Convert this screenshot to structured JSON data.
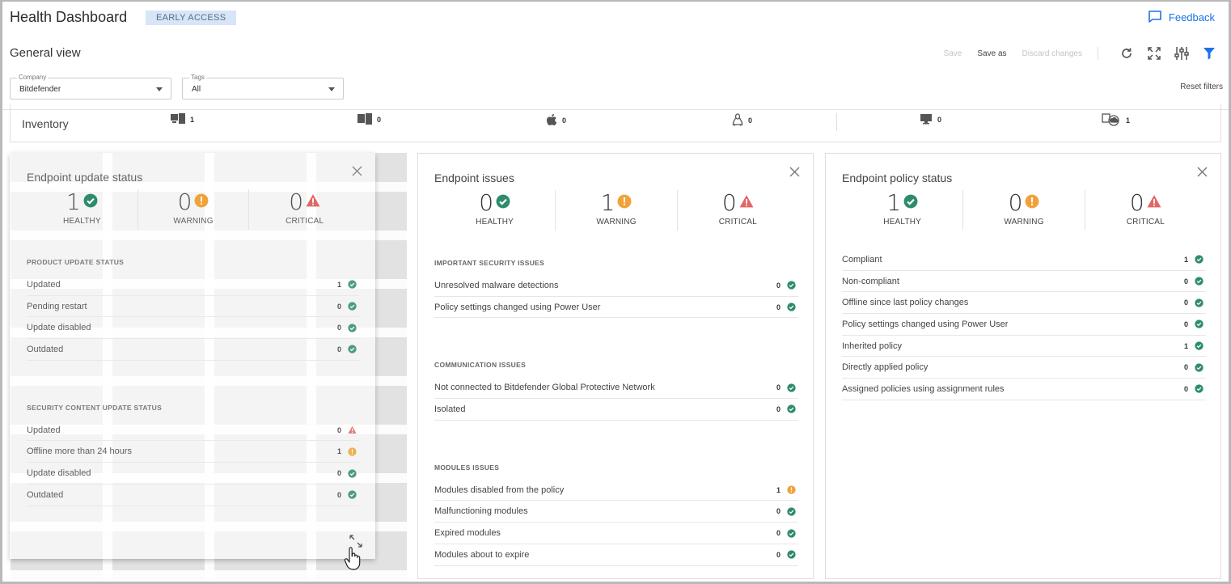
{
  "header": {
    "title": "Health Dashboard",
    "badge": "EARLY ACCESS",
    "feedback": "Feedback"
  },
  "view": {
    "name": "General view",
    "save": "Save",
    "save_as": "Save as",
    "discard": "Discard changes",
    "reset_filters": "Reset filters"
  },
  "filters": {
    "company": {
      "label": "Company",
      "value": "Bitdefender"
    },
    "tags": {
      "label": "Tags",
      "value": "All"
    }
  },
  "inventory": {
    "label": "Inventory",
    "items": [
      {
        "icon": "windows-workstation-icon",
        "count": "1"
      },
      {
        "icon": "windows-server-icon",
        "count": "0"
      },
      {
        "icon": "apple-icon",
        "count": "0"
      },
      {
        "icon": "linux-icon",
        "count": "0"
      },
      {
        "icon": "desktop-icon",
        "count": "0"
      },
      {
        "icon": "cloud-workload-icon",
        "count": "1"
      }
    ]
  },
  "colors": {
    "healthy": "#2e8b6e",
    "warning": "#f0a23a",
    "critical": "#e26666",
    "accent": "#1a73e8"
  },
  "cards": {
    "update": {
      "title": "Endpoint update status",
      "stats": [
        {
          "value": "1",
          "label": "HEALTHY",
          "status": "healthy"
        },
        {
          "value": "0",
          "label": "WARNING",
          "status": "warning"
        },
        {
          "value": "0",
          "label": "CRITICAL",
          "status": "critical"
        }
      ],
      "sections": [
        {
          "title": "PRODUCT UPDATE STATUS",
          "items": [
            {
              "label": "Updated",
              "count": "1",
              "status": "healthy"
            },
            {
              "label": "Pending restart",
              "count": "0",
              "status": "healthy"
            },
            {
              "label": "Update disabled",
              "count": "0",
              "status": "healthy"
            },
            {
              "label": "Outdated",
              "count": "0",
              "status": "healthy"
            }
          ]
        },
        {
          "title": "SECURITY CONTENT UPDATE STATUS",
          "items": [
            {
              "label": "Updated",
              "count": "0",
              "status": "critical"
            },
            {
              "label": "Offline more than 24 hours",
              "count": "1",
              "status": "warning"
            },
            {
              "label": "Update disabled",
              "count": "0",
              "status": "healthy"
            },
            {
              "label": "Outdated",
              "count": "0",
              "status": "healthy"
            }
          ]
        }
      ]
    },
    "issues": {
      "title": "Endpoint issues",
      "stats": [
        {
          "value": "0",
          "label": "HEALTHY",
          "status": "healthy"
        },
        {
          "value": "1",
          "label": "WARNING",
          "status": "warning"
        },
        {
          "value": "0",
          "label": "CRITICAL",
          "status": "critical"
        }
      ],
      "sections": [
        {
          "title": "IMPORTANT SECURITY ISSUES",
          "items": [
            {
              "label": "Unresolved malware detections",
              "count": "0",
              "status": "healthy"
            },
            {
              "label": "Policy settings changed using Power User",
              "count": "0",
              "status": "healthy"
            }
          ]
        },
        {
          "title": "COMMUNICATION ISSUES",
          "items": [
            {
              "label": "Not connected to Bitdefender Global Protective Network",
              "count": "0",
              "status": "healthy"
            },
            {
              "label": "Isolated",
              "count": "0",
              "status": "healthy"
            }
          ]
        },
        {
          "title": "MODULES ISSUES",
          "items": [
            {
              "label": "Modules disabled from the policy",
              "count": "1",
              "status": "warning"
            },
            {
              "label": "Malfunctioning modules",
              "count": "0",
              "status": "healthy"
            },
            {
              "label": "Expired modules",
              "count": "0",
              "status": "healthy"
            },
            {
              "label": "Modules about to expire",
              "count": "0",
              "status": "healthy"
            }
          ]
        }
      ]
    },
    "policy": {
      "title": "Endpoint policy status",
      "stats": [
        {
          "value": "1",
          "label": "HEALTHY",
          "status": "healthy"
        },
        {
          "value": "0",
          "label": "WARNING",
          "status": "warning"
        },
        {
          "value": "0",
          "label": "CRITICAL",
          "status": "critical"
        }
      ],
      "sections": [
        {
          "title": "",
          "items": [
            {
              "label": "Compliant",
              "count": "1",
              "status": "healthy"
            },
            {
              "label": "Non-compliant",
              "count": "0",
              "status": "healthy"
            },
            {
              "label": "Offline since last policy changes",
              "count": "0",
              "status": "healthy"
            },
            {
              "label": "Policy settings changed using Power User",
              "count": "0",
              "status": "healthy"
            },
            {
              "label": "Inherited policy",
              "count": "1",
              "status": "healthy"
            },
            {
              "label": "Directly applied policy",
              "count": "0",
              "status": "healthy"
            },
            {
              "label": "Assigned policies using assignment rules",
              "count": "0",
              "status": "healthy"
            }
          ]
        }
      ]
    }
  }
}
